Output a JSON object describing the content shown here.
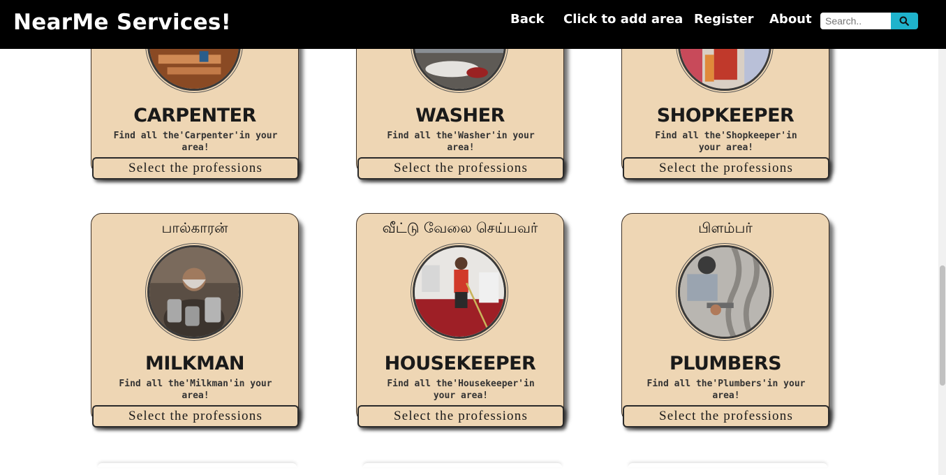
{
  "navbar": {
    "brand": "NearMe Services!",
    "links": [
      "Back",
      "Click to add area",
      "Register",
      "About"
    ],
    "search_placeholder": "Search..",
    "search_icon": "search-icon",
    "colors": {
      "background": "#000000",
      "search_button": "#1fb3cc"
    }
  },
  "card_colors": {
    "background": "#eed6b4",
    "border": "#3a2e24"
  },
  "cards": [
    {
      "title": "CARPENTER",
      "description": "Find all the'Carpenter'in your area!",
      "button": "Select the professions",
      "photo": "carpenter-photo"
    },
    {
      "title": "WASHER",
      "description": "Find all the'Washer'in your area!",
      "button": "Select the professions",
      "photo": "washer-photo"
    },
    {
      "title": "SHOPKEEPER",
      "description": "Find all the'Shopkeeper'in your area!",
      "button": "Select the professions",
      "photo": "shopkeeper-photo"
    },
    {
      "native": "பால்காரன்",
      "title": "MILKMAN",
      "description": "Find all the'Milkman'in your area!",
      "button": "Select the professions",
      "photo": "milkman-photo"
    },
    {
      "native": "வீட்டு வேலை செய்பவர்",
      "title": "HOUSEKEEPER",
      "description": "Find all the'Housekeeper'in your area!",
      "button": "Select the professions",
      "photo": "housekeeper-photo"
    },
    {
      "native": "பிளம்பர்",
      "title": "PLUMBERS",
      "description": "Find all the'Plumbers'in your area!",
      "button": "Select the professions",
      "photo": "plumber-photo"
    }
  ]
}
